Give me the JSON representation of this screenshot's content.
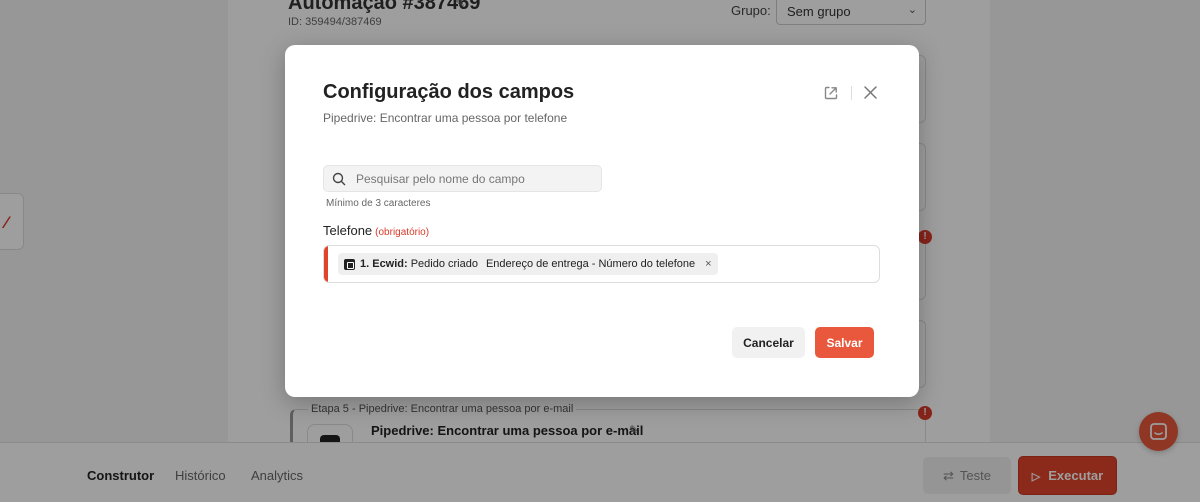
{
  "background": {
    "automation_title": "Automação #387469",
    "automation_id": "ID: 359494/387469",
    "group_label": "Grupo:",
    "group_value": "Sem grupo",
    "step5_label": "Etapa 5 - Pipedrive: Encontrar uma pessoa por e-mail",
    "step5_title": "Pipedrive: Encontrar uma pessoa por e-mail"
  },
  "bottom_bar": {
    "tabs": [
      {
        "label": "Construtor",
        "active": true
      },
      {
        "label": "Histórico",
        "active": false
      },
      {
        "label": "Analytics",
        "active": false
      }
    ],
    "test_label": "Teste",
    "execute_label": "Executar"
  },
  "modal": {
    "title": "Configuração dos campos",
    "subtitle": "Pipedrive: Encontrar uma pessoa por telefone",
    "search": {
      "placeholder": "Pesquisar pelo nome do campo",
      "value": "",
      "hint": "Mínimo de 3 caracteres"
    },
    "field": {
      "label": "Telefone",
      "required_text": "(obrigatório)",
      "chip": {
        "step": "1. Ecwid:",
        "event": "Pedido criado",
        "path": "Endereço de entrega - Número do telefone",
        "remove_symbol": "×"
      }
    },
    "cancel_label": "Cancelar",
    "save_label": "Salvar"
  },
  "colors": {
    "accent": "#e9573c",
    "required": "#d93a2b"
  }
}
